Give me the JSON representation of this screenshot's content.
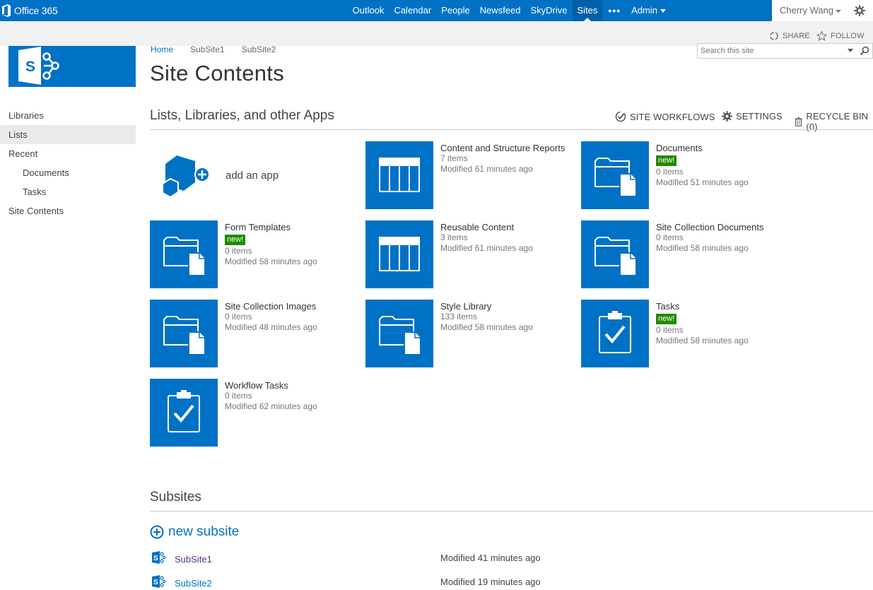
{
  "suite": {
    "brand": "Office 365",
    "nav": [
      "Outlook",
      "Calendar",
      "People",
      "Newsfeed",
      "SkyDrive",
      "Sites"
    ],
    "ellipsis": "•••",
    "admin": "Admin",
    "user": "Cherry Wang"
  },
  "toolbar": {
    "share": "SHARE",
    "follow": "FOLLOW"
  },
  "breadcrumb": {
    "home": "Home",
    "sub1": "SubSite1",
    "sub2": "SubSite2"
  },
  "page_title": "Site Contents",
  "search": {
    "placeholder": "Search this site"
  },
  "leftnav": {
    "libraries": "Libraries",
    "lists": "Lists",
    "recent": "Recent",
    "documents": "Documents",
    "tasks": "Tasks",
    "site_contents": "Site Contents"
  },
  "section": {
    "title": "Lists, Libraries, and other Apps",
    "workflows": "SITE WORKFLOWS",
    "settings": "SETTINGS",
    "recycle": "RECYCLE BIN (0)"
  },
  "add_app": "add an app",
  "tiles": [
    {
      "name": "Content and Structure Reports",
      "badge": "",
      "items": "7 items",
      "modified": "Modified 61 minutes ago",
      "icon": "list-icon"
    },
    {
      "name": "Documents",
      "badge": "new!",
      "items": "0 items",
      "modified": "Modified 51 minutes ago",
      "icon": "folder-icon"
    },
    {
      "name": "Form Templates",
      "badge": "new!",
      "items": "0 items",
      "modified": "Modified 58 minutes ago",
      "icon": "folder-icon"
    },
    {
      "name": "Reusable Content",
      "badge": "",
      "items": "3 items",
      "modified": "Modified 61 minutes ago",
      "icon": "list-icon"
    },
    {
      "name": "Site Collection Documents",
      "badge": "",
      "items": "0 items",
      "modified": "Modified 58 minutes ago",
      "icon": "folder-icon"
    },
    {
      "name": "Site Collection Images",
      "badge": "",
      "items": "0 items",
      "modified": "Modified 48 minutes ago",
      "icon": "folder-icon"
    },
    {
      "name": "Style Library",
      "badge": "",
      "items": "133 items",
      "modified": "Modified 58 minutes ago",
      "icon": "folder-icon"
    },
    {
      "name": "Tasks",
      "badge": "new!",
      "items": "0 items",
      "modified": "Modified 58 minutes ago",
      "icon": "clipboard-check-icon"
    },
    {
      "name": "Workflow Tasks",
      "badge": "",
      "items": "0 items",
      "modified": "Modified 62 minutes ago",
      "icon": "clipboard-check-icon"
    }
  ],
  "subsites": {
    "title": "Subsites",
    "new_label": "new subsite",
    "rows": [
      {
        "name": "SubSite1",
        "modified": "Modified 41 minutes ago"
      },
      {
        "name": "SubSite2",
        "modified": "Modified 19 minutes ago"
      }
    ]
  },
  "colors": {
    "brand_blue": "#0072c6",
    "badge_green": "#218a00"
  }
}
